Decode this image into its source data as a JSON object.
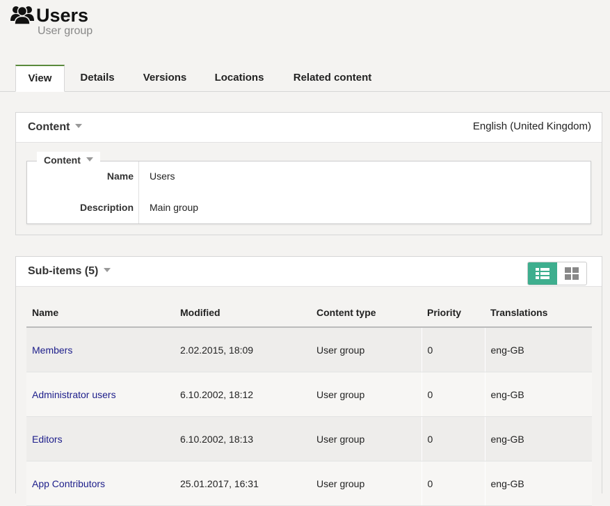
{
  "header": {
    "title": "Users",
    "subtitle": "User group",
    "icon": "users-icon"
  },
  "tabs": [
    {
      "label": "View",
      "active": true
    },
    {
      "label": "Details",
      "active": false
    },
    {
      "label": "Versions",
      "active": false
    },
    {
      "label": "Locations",
      "active": false
    },
    {
      "label": "Related content",
      "active": false
    }
  ],
  "content_panel": {
    "title": "Content",
    "language": "English (United Kingdom)",
    "fieldset_title": "Content",
    "fields": [
      {
        "label": "Name",
        "value": "Users"
      },
      {
        "label": "Description",
        "value": "Main group"
      }
    ]
  },
  "subitems_panel": {
    "title": "Sub-items (5)",
    "view_toggle": {
      "list_icon": "list-view-icon",
      "grid_icon": "grid-view-icon",
      "active": "list"
    },
    "columns": [
      "Name",
      "Modified",
      "Content type",
      "Priority",
      "Translations"
    ],
    "rows": [
      {
        "name": "Members",
        "modified": "2.02.2015, 18:09",
        "type": "User group",
        "priority": "0",
        "translations": "eng-GB"
      },
      {
        "name": "Administrator users",
        "modified": "6.10.2002, 18:12",
        "type": "User group",
        "priority": "0",
        "translations": "eng-GB"
      },
      {
        "name": "Editors",
        "modified": "6.10.2002, 18:13",
        "type": "User group",
        "priority": "0",
        "translations": "eng-GB"
      },
      {
        "name": "App Contributors",
        "modified": "25.01.2017, 16:31",
        "type": "User group",
        "priority": "0",
        "translations": "eng-GB"
      }
    ]
  },
  "colors": {
    "accent_active_tab": "#5a8a3c",
    "toggle_active": "#3eae8e",
    "link": "#1c1d8a"
  }
}
